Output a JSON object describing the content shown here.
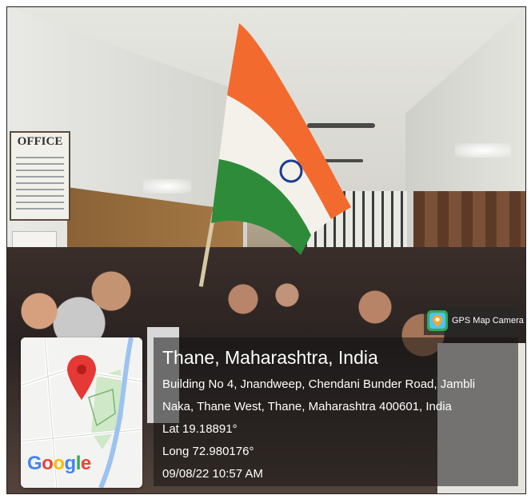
{
  "scene": {
    "office_sign": "OFFICE"
  },
  "badge": {
    "label": "GPS Map Camera",
    "icon": "gps-map-camera-app-icon"
  },
  "map": {
    "icon": "map-pin-icon",
    "google_letters": [
      {
        "ch": "G",
        "color": "#4285F4"
      },
      {
        "ch": "o",
        "color": "#EA4335"
      },
      {
        "ch": "o",
        "color": "#FBBC05"
      },
      {
        "ch": "g",
        "color": "#4285F4"
      },
      {
        "ch": "l",
        "color": "#34A853"
      },
      {
        "ch": "e",
        "color": "#EA4335"
      }
    ]
  },
  "location": {
    "title": "Thane, Maharashtra, India",
    "address_line1": "Building No 4, Jnandweep, Chendani Bunder Road, Jambli",
    "address_line2": "Naka, Thane West, Thane, Maharashtra 400601, India",
    "lat": "Lat 19.18891°",
    "long": "Long 72.980176°",
    "datetime": "09/08/22 10:57 AM"
  },
  "colors": {
    "saffron": "#F26A2E",
    "india_green": "#2E8B3A",
    "chakra_blue": "#1D3C8F",
    "pin_red": "#E53935",
    "overlay": "#141414"
  }
}
